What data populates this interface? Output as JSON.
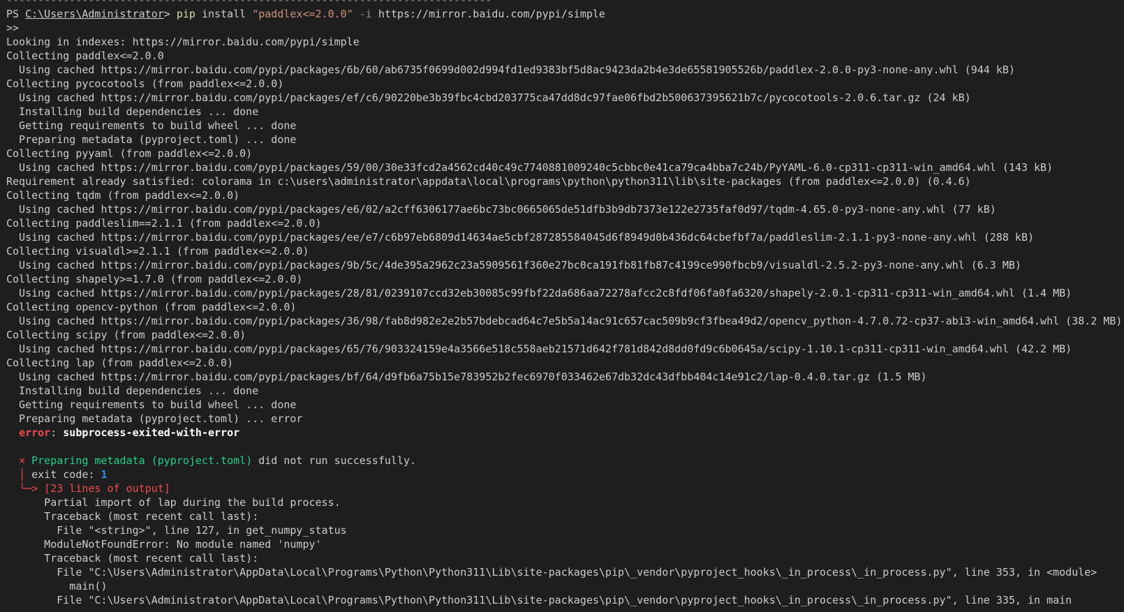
{
  "terminal": {
    "lines": [
      [
        {
          "t": "-----------------------------------------------------------------------------",
          "c": "cut-top"
        }
      ],
      [
        {
          "t": "PS ",
          "c": ""
        },
        {
          "t": "C:\\Users\\Administrator",
          "c": "u"
        },
        {
          "t": "> ",
          "c": ""
        },
        {
          "t": "pip",
          "c": "yellow"
        },
        {
          "t": " install ",
          "c": ""
        },
        {
          "t": "\"paddlex<=2.0.0\"",
          "c": "string"
        },
        {
          "t": " ",
          "c": ""
        },
        {
          "t": "-i",
          "c": "dim"
        },
        {
          "t": " https://mirror.baidu.com/pypi/simple",
          "c": ""
        }
      ],
      [
        {
          "t": ">>",
          "c": ""
        }
      ],
      [
        {
          "t": "Looking in indexes: https://mirror.baidu.com/pypi/simple",
          "c": ""
        }
      ],
      [
        {
          "t": "Collecting paddlex<=2.0.0",
          "c": ""
        }
      ],
      [
        {
          "t": "  Using cached https://mirror.baidu.com/pypi/packages/6b/60/ab6735f0699d002d994fd1ed9383bf5d8ac9423da2b4e3de65581905526b/paddlex-2.0.0-py3-none-any.whl (944 kB)",
          "c": ""
        }
      ],
      [
        {
          "t": "Collecting pycocotools (from paddlex<=2.0.0)",
          "c": ""
        }
      ],
      [
        {
          "t": "  Using cached https://mirror.baidu.com/pypi/packages/ef/c6/90220be3b39fbc4cbd203775ca47dd8dc97fae06fbd2b500637395621b7c/pycocotools-2.0.6.tar.gz (24 kB)",
          "c": ""
        }
      ],
      [
        {
          "t": "  Installing build dependencies ... done",
          "c": ""
        }
      ],
      [
        {
          "t": "  Getting requirements to build wheel ... done",
          "c": ""
        }
      ],
      [
        {
          "t": "  Preparing metadata (pyproject.toml) ... done",
          "c": ""
        }
      ],
      [
        {
          "t": "Collecting pyyaml (from paddlex<=2.0.0)",
          "c": ""
        }
      ],
      [
        {
          "t": "  Using cached https://mirror.baidu.com/pypi/packages/59/00/30e33fcd2a4562cd40c49c7740881009240c5cbbc0e41ca79ca4bba7c24b/PyYAML-6.0-cp311-cp311-win_amd64.whl (143 kB)",
          "c": ""
        }
      ],
      [
        {
          "t": "Requirement already satisfied: colorama in c:\\users\\administrator\\appdata\\local\\programs\\python\\python311\\lib\\site-packages (from paddlex<=2.0.0) (0.4.6)",
          "c": ""
        }
      ],
      [
        {
          "t": "Collecting tqdm (from paddlex<=2.0.0)",
          "c": ""
        }
      ],
      [
        {
          "t": "  Using cached https://mirror.baidu.com/pypi/packages/e6/02/a2cff6306177ae6bc73bc0665065de51dfb3b9db7373e122e2735faf0d97/tqdm-4.65.0-py3-none-any.whl (77 kB)",
          "c": ""
        }
      ],
      [
        {
          "t": "Collecting paddleslim==2.1.1 (from paddlex<=2.0.0)",
          "c": ""
        }
      ],
      [
        {
          "t": "  Using cached https://mirror.baidu.com/pypi/packages/ee/e7/c6b97eb6809d14634ae5cbf287285584045d6f8949d0b436dc64cbefbf7a/paddleslim-2.1.1-py3-none-any.whl (288 kB)",
          "c": ""
        }
      ],
      [
        {
          "t": "Collecting visualdl>=2.1.1 (from paddlex<=2.0.0)",
          "c": ""
        }
      ],
      [
        {
          "t": "  Using cached https://mirror.baidu.com/pypi/packages/9b/5c/4de395a2962c23a5909561f360e27bc0ca191fb81fb87c4199ce990fbcb9/visualdl-2.5.2-py3-none-any.whl (6.3 MB)",
          "c": ""
        }
      ],
      [
        {
          "t": "Collecting shapely>=1.7.0 (from paddlex<=2.0.0)",
          "c": ""
        }
      ],
      [
        {
          "t": "  Using cached https://mirror.baidu.com/pypi/packages/28/81/0239107ccd32eb30085c99fbf22da686aa72278afcc2c8fdf06fa0fa6320/shapely-2.0.1-cp311-cp311-win_amd64.whl (1.4 MB)",
          "c": ""
        }
      ],
      [
        {
          "t": "Collecting opencv-python (from paddlex<=2.0.0)",
          "c": ""
        }
      ],
      [
        {
          "t": "  Using cached https://mirror.baidu.com/pypi/packages/36/98/fab8d982e2e2b57bdebcad64c7e5b5a14ac91c657cac509b9cf3fbea49d2/opencv_python-4.7.0.72-cp37-abi3-win_amd64.whl (38.2 MB)",
          "c": ""
        }
      ],
      [
        {
          "t": "Collecting scipy (from paddlex<=2.0.0)",
          "c": ""
        }
      ],
      [
        {
          "t": "  Using cached https://mirror.baidu.com/pypi/packages/65/76/903324159e4a3566e518c558aeb21571d642f781d842d8dd0fd9c6b0645a/scipy-1.10.1-cp311-cp311-win_amd64.whl (42.2 MB)",
          "c": ""
        }
      ],
      [
        {
          "t": "Collecting lap (from paddlex<=2.0.0)",
          "c": ""
        }
      ],
      [
        {
          "t": "  Using cached https://mirror.baidu.com/pypi/packages/bf/64/d9fb6a75b15e783952b2fec6970f033462e67db32dc43dfbb404c14e91c2/lap-0.4.0.tar.gz (1.5 MB)",
          "c": ""
        }
      ],
      [
        {
          "t": "  Installing build dependencies ... done",
          "c": ""
        }
      ],
      [
        {
          "t": "  Getting requirements to build wheel ... done",
          "c": ""
        }
      ],
      [
        {
          "t": "  Preparing metadata (pyproject.toml) ... error",
          "c": ""
        }
      ],
      [
        {
          "t": "  ",
          "c": ""
        },
        {
          "t": "error",
          "c": "err"
        },
        {
          "t": ": ",
          "c": ""
        },
        {
          "t": "subprocess-exited-with-error",
          "c": "bold-white"
        }
      ],
      [
        {
          "t": "",
          "c": ""
        }
      ],
      [
        {
          "t": "  ",
          "c": ""
        },
        {
          "t": "×",
          "c": "red"
        },
        {
          "t": " ",
          "c": ""
        },
        {
          "t": "Preparing metadata (",
          "c": "green"
        },
        {
          "t": "pyproject.toml",
          "c": "green"
        },
        {
          "t": ")",
          "c": "green"
        },
        {
          "t": " did not run successfully.",
          "c": ""
        }
      ],
      [
        {
          "t": "  ",
          "c": ""
        },
        {
          "t": "│",
          "c": "red"
        },
        {
          "t": " exit code: ",
          "c": ""
        },
        {
          "t": "1",
          "c": "blue-num"
        }
      ],
      [
        {
          "t": "  ",
          "c": ""
        },
        {
          "t": "╰─>",
          "c": "red"
        },
        {
          "t": " [23 lines of output]",
          "c": "red"
        }
      ],
      [
        {
          "t": "      Partial import of lap during the build process.",
          "c": ""
        }
      ],
      [
        {
          "t": "      Traceback (most recent call last):",
          "c": ""
        }
      ],
      [
        {
          "t": "        File \"<string>\", line 127, in get_numpy_status",
          "c": ""
        }
      ],
      [
        {
          "t": "      ModuleNotFoundError: No module named 'numpy'",
          "c": ""
        }
      ],
      [
        {
          "t": "      Traceback (most recent call last):",
          "c": ""
        }
      ],
      [
        {
          "t": "        File \"C:\\Users\\Administrator\\AppData\\Local\\Programs\\Python\\Python311\\Lib\\site-packages\\pip\\_vendor\\pyproject_hooks\\_in_process\\_in_process.py\", line 353, in <module>",
          "c": ""
        }
      ],
      [
        {
          "t": "          main()",
          "c": ""
        }
      ],
      [
        {
          "t": "        File \"C:\\Users\\Administrator\\AppData\\Local\\Programs\\Python\\Python311\\Lib\\site-packages\\pip\\_vendor\\pyproject_hooks\\_in_process\\_in_process.py\", line 335, in main",
          "c": ""
        }
      ]
    ]
  }
}
